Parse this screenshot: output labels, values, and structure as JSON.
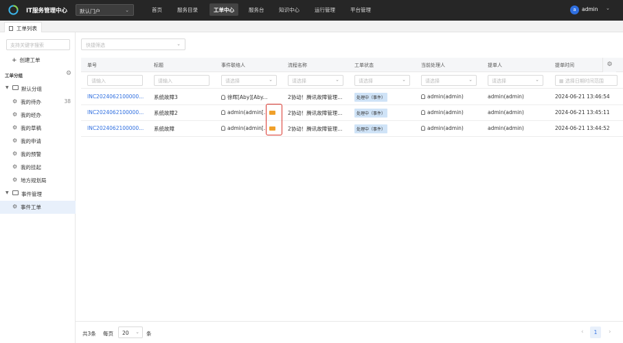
{
  "app": {
    "title": "IT服务管理中心",
    "portal": "默认门户",
    "nav": [
      "首页",
      "服务目录",
      "工单中心",
      "服务台",
      "知识中心",
      "运行管理",
      "平台管理"
    ],
    "active_nav": "工单中心",
    "user_initial": "a",
    "user_name": "admin"
  },
  "tab": {
    "label": "工单列表"
  },
  "sidebar": {
    "search_placeholder": "支持关键字搜索",
    "create_label": "创建工单",
    "group_title": "工单分组",
    "tree": [
      {
        "label": "默认分组",
        "type": "group"
      },
      {
        "label": "我的待办",
        "type": "item",
        "count": "38"
      },
      {
        "label": "我的经办",
        "type": "item"
      },
      {
        "label": "我的草稿",
        "type": "item"
      },
      {
        "label": "我的申请",
        "type": "item"
      },
      {
        "label": "我的预警",
        "type": "item"
      },
      {
        "label": "我的挂起",
        "type": "item"
      },
      {
        "label": "地方规划局",
        "type": "item"
      },
      {
        "label": "事件管理",
        "type": "group"
      },
      {
        "label": "事件工单",
        "type": "item",
        "selected": true
      }
    ]
  },
  "main": {
    "filter_placeholder": "快捷筛选",
    "columns": [
      "单号",
      "标题",
      "事件联络人",
      "流程名称",
      "工单状态",
      "当前处理人",
      "提单人",
      "提单时间"
    ],
    "filters": {
      "input": "请输入",
      "select": "请选择",
      "date": "选择日期时间范围"
    },
    "rows": [
      {
        "id": "INC2024062100000...",
        "title": "系统故障3",
        "contact": "徐晖[Aby][Aby...",
        "flow": "2协动！腾讯故障管理...",
        "status": "处理中（事件）",
        "handler": "admin(admin)",
        "submitter": "admin(admin)",
        "time": "2024-06-21 13:46:54",
        "vip": false
      },
      {
        "id": "INC2024062100000...",
        "title": "系统故障2",
        "contact": "admin(admin[...",
        "flow": "2协动！腾讯故障管理...",
        "status": "处理中（事件）",
        "handler": "admin(admin)",
        "submitter": "admin(admin)",
        "time": "2024-06-21 13:45:11",
        "vip": true
      },
      {
        "id": "INC2024062100000...",
        "title": "系统故障",
        "contact": "admin(admin[...",
        "flow": "2协动！腾讯故障管理...",
        "status": "处理中（事件）",
        "handler": "admin(admin)",
        "submitter": "admin(admin)",
        "time": "2024-06-21 13:44:52",
        "vip": true
      }
    ]
  },
  "pager": {
    "total": "共3条",
    "per_page_label": "每页",
    "page_size": "20",
    "unit": "条",
    "current_page": "1"
  },
  "colors": {
    "accent": "#2f6fe0",
    "status_badge": "#cfe3f7",
    "topbar": "#262626",
    "highlight": "#d9342b",
    "vip_tag": "#f0a02a"
  }
}
